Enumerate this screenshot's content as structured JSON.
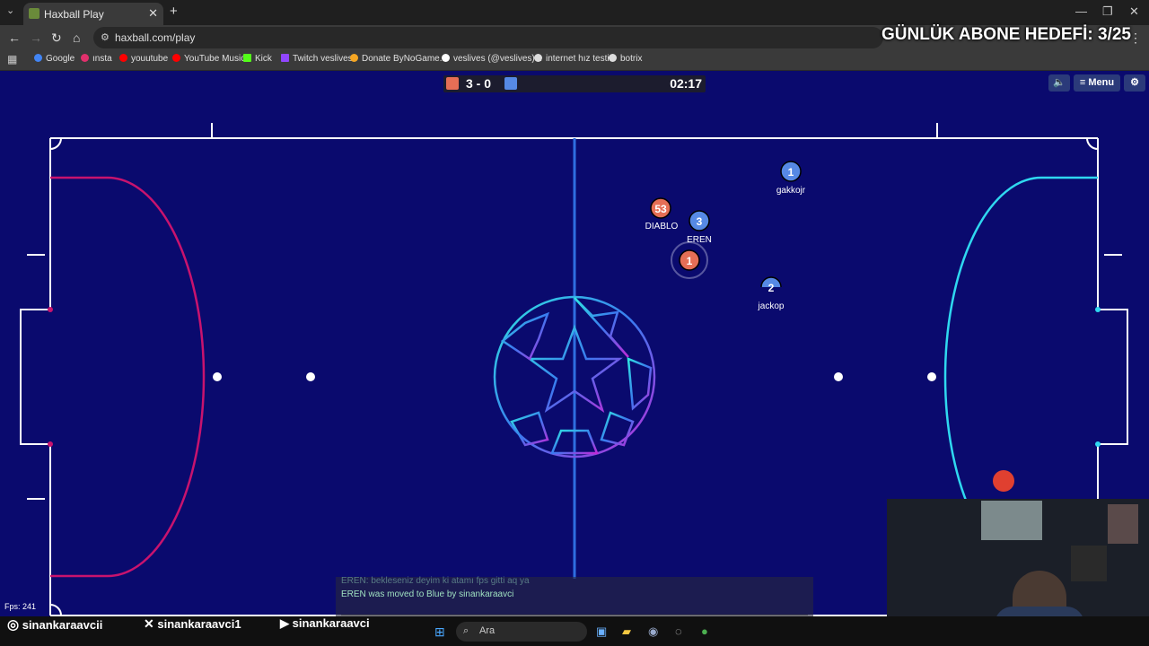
{
  "browser": {
    "tab_title": "Haxball Play",
    "url": "haxball.com/play",
    "bookmarks": [
      {
        "label": "Google",
        "color": "#4285f4"
      },
      {
        "label": "ınsta",
        "color": "#e1306c"
      },
      {
        "label": "youutube",
        "color": "#ff0000"
      },
      {
        "label": "YouTube Music",
        "color": "#ff0000"
      },
      {
        "label": "Kick",
        "color": "#53fc18"
      },
      {
        "label": "Twitch veslives",
        "color": "#9146ff"
      },
      {
        "label": "Donate ByNoGame...",
        "color": "#f5a623"
      },
      {
        "label": "veslives (@veslives)...",
        "color": "#ffffff"
      },
      {
        "label": "internet hız testi",
        "color": "#dddddd"
      },
      {
        "label": "botrix",
        "color": "#dddddd"
      }
    ]
  },
  "overlay": {
    "goal_text": "GÜNLÜK ABONE HEDEFİ: 3/25"
  },
  "hud": {
    "score": "3 - 0",
    "time": "02:17",
    "menu_label": "≡ Menu",
    "sound_icon": "speaker-icon",
    "settings_icon": "gear-icon",
    "red_color": "#e56e56",
    "blue_color": "#5689e5"
  },
  "players": [
    {
      "number": "53",
      "name": "DIABLO",
      "team": "red"
    },
    {
      "number": "3",
      "name": "EREN",
      "team": "blue"
    },
    {
      "number": "1",
      "name": "",
      "team": "red"
    },
    {
      "number": "1",
      "name": "gakkojr",
      "team": "blue"
    },
    {
      "number": "2",
      "name": "jackop",
      "team": "blue"
    }
  ],
  "chat": {
    "lines": [
      "EREN: bekleseniz deyim ki atamı fps gitti aq ya",
      "EREN was moved to Blue by sinankaraavci"
    ]
  },
  "fps": "Fps: 241",
  "socials": [
    "sinankaraavcii",
    "sinankaraavci1",
    "sinankaraavci"
  ],
  "taskbar": {
    "search_placeholder": "Ara"
  },
  "colors": {
    "field": "#0a0a6e",
    "red_area": "#c8136e",
    "blue_area": "#2fd8f0"
  }
}
